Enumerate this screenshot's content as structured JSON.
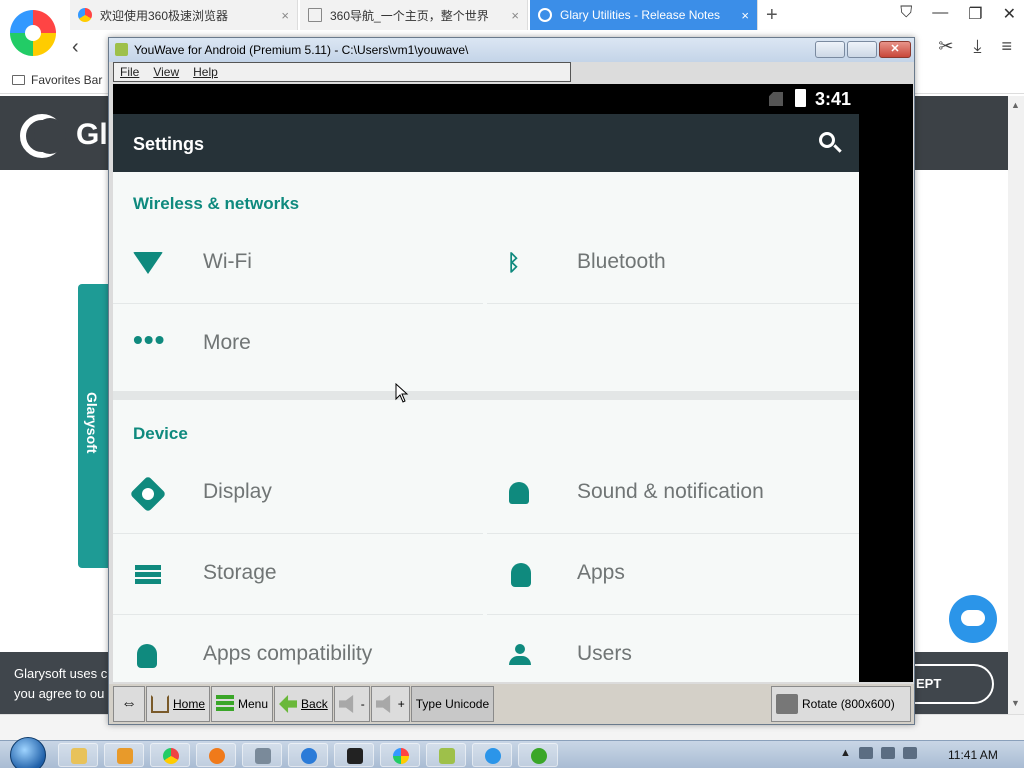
{
  "browser": {
    "tabs": [
      {
        "label": "欢迎使用360极速浏览器",
        "close": "×",
        "active": false,
        "color": "#e44"
      },
      {
        "label": "360导航_一个主页，整个世界",
        "close": "×",
        "active": false,
        "color": "#888"
      },
      {
        "label": "Glary Utilities - Release Notes",
        "close": "×",
        "active": true,
        "color": "#2b95e9"
      }
    ],
    "new_tab": "+",
    "favorites_label": "Favorites Bar"
  },
  "website": {
    "brand": "Gl",
    "side_tab": "Glarysoft",
    "cookie_text": [
      "Glarysoft uses c",
      "you agree to ou"
    ],
    "accept_label": "EPT"
  },
  "youwave": {
    "title": "YouWave for Android (Premium 5.11) - C:\\Users\\vm1\\youwave\\",
    "menu": [
      "File",
      "View",
      "Help"
    ],
    "toolbar": {
      "home": "Home",
      "menu": "Menu",
      "back": "Back",
      "vol_down": "-",
      "vol_up": "+",
      "type_unicode": "Type Unicode",
      "rotate": "Rotate (800x600)"
    }
  },
  "android": {
    "status_time": "3:41",
    "toolbar_title": "Settings",
    "sections": [
      {
        "title": "Wireless & networks",
        "items": [
          {
            "label": "Wi-Fi",
            "icon": "wifi-icon"
          },
          {
            "label": "Bluetooth",
            "icon": "bluetooth-icon"
          },
          {
            "label": "More",
            "icon": "more-icon"
          }
        ]
      },
      {
        "title": "Device",
        "items": [
          {
            "label": "Display",
            "icon": "brightness-icon"
          },
          {
            "label": "Sound & notification",
            "icon": "bell-icon"
          },
          {
            "label": "Storage",
            "icon": "storage-icon"
          },
          {
            "label": "Apps",
            "icon": "android-icon"
          },
          {
            "label": "Apps compatibility",
            "icon": "android-icon"
          },
          {
            "label": "Users",
            "icon": "user-icon"
          }
        ]
      }
    ],
    "accent_color": "#0f8a7e",
    "toolbar_color": "#263238"
  },
  "taskbar": {
    "clock": "11:41 AM"
  }
}
